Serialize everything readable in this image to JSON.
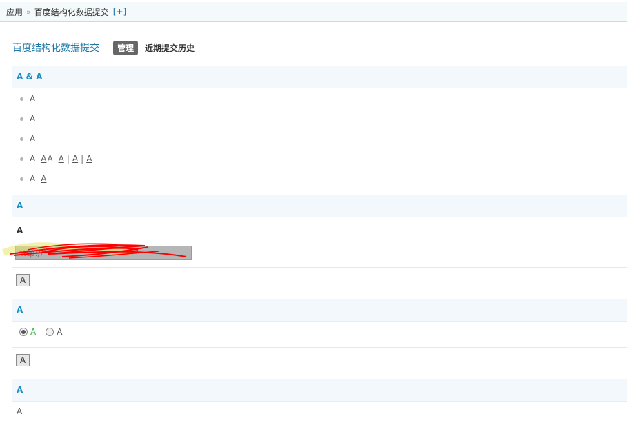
{
  "breadcrumb": {
    "root": "应用",
    "separator": "»",
    "current": "百度结构化数据提交",
    "add": "[+]"
  },
  "header": {
    "title": "百度结构化数据提交",
    "manage_badge": "管理",
    "history_link": "近期提交历史"
  },
  "section1": {
    "heading": "A & A",
    "items": [
      {
        "text": "A"
      },
      {
        "text": "A"
      },
      {
        "text": "A"
      },
      {
        "text": "A",
        "links": [
          "A",
          "A",
          "A",
          "A",
          "A"
        ]
      },
      {
        "text": "A",
        "links": [
          "A"
        ]
      }
    ]
  },
  "section2": {
    "heading": "A",
    "label": "A",
    "input_value": "http://",
    "button": "A"
  },
  "section3": {
    "heading": "A",
    "radio_options": [
      {
        "label": "A",
        "checked": true
      },
      {
        "label": "A",
        "checked": false
      }
    ],
    "button": "A"
  },
  "section4": {
    "heading": "A",
    "text": "A"
  },
  "colors": {
    "accent": "#1a8fc0",
    "title": "#1a77a8",
    "badge": "#666666",
    "scribble": "#ff0000",
    "highlight": "#e8e86a"
  }
}
